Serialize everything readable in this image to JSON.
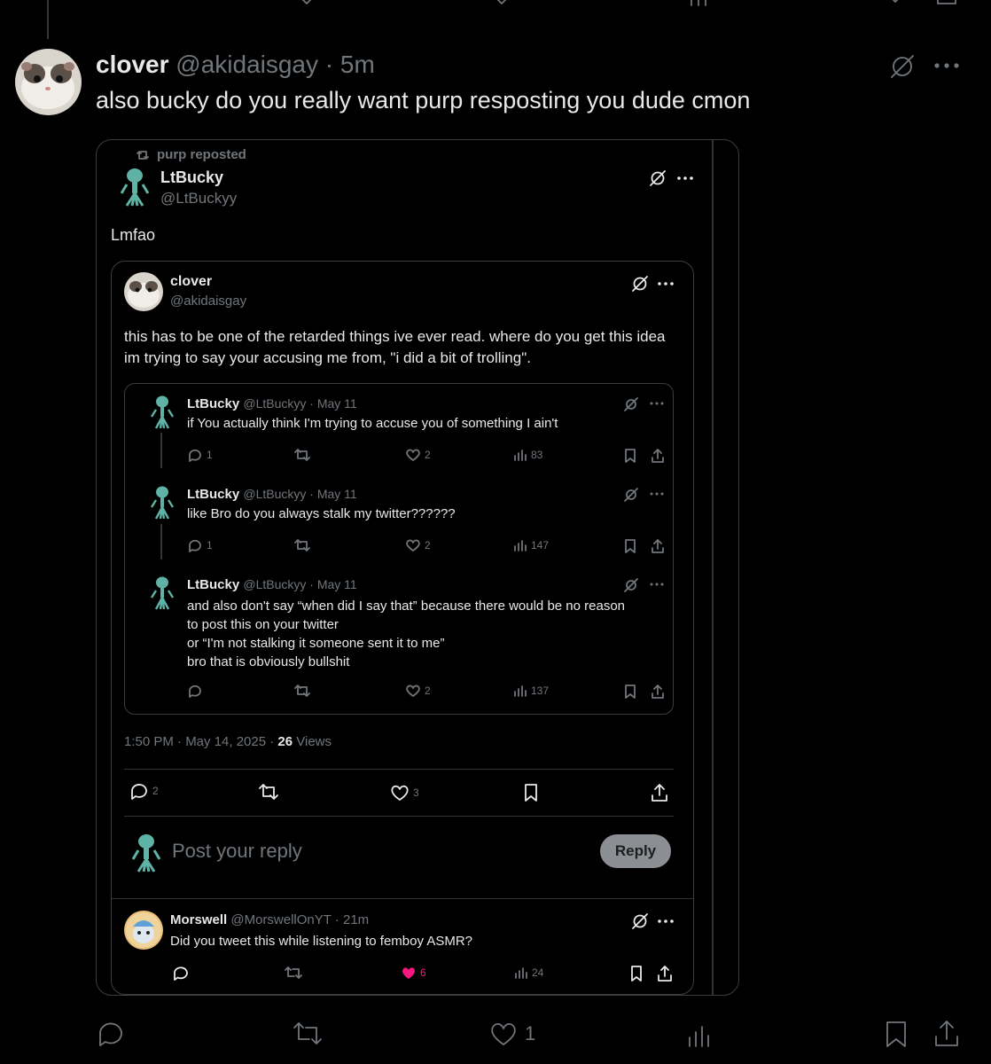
{
  "outer_tweet": {
    "display_name": "clover",
    "handle": "@akidaisgay",
    "separator": "·",
    "time": "5m",
    "text": "also bucky do you really want purp resposting you dude cmon",
    "actions": {
      "likes": "1"
    }
  },
  "screenshot": {
    "repost_label": "purp reposted",
    "main": {
      "display_name": "LtBucky",
      "handle": "@LtBuckyy",
      "text": "Lmfao"
    },
    "quoted": {
      "display_name": "clover",
      "handle": "@akidaisgay",
      "text": "this has to be one of the retarded things ive ever read. where do you get this idea im trying to say your accusing me from, \"i did a bit of trolling\"."
    },
    "thread": [
      {
        "display_name": "LtBucky",
        "meta": "@LtBuckyy · May 11",
        "text": "if You actually think I'm trying to accuse you of something I ain't",
        "replies": "1",
        "likes": "2",
        "views": "83"
      },
      {
        "display_name": "LtBucky",
        "meta": "@LtBuckyy · May 11",
        "text": "like Bro do you always stalk my twitter??????",
        "replies": "1",
        "likes": "2",
        "views": "147"
      },
      {
        "display_name": "LtBucky",
        "meta": "@LtBuckyy · May 11",
        "text_lines": [
          "and also don't say “when did I say that” because there would be no reason",
          "to post this on your twitter",
          "or “I'm not stalking it someone sent it to me”",
          "bro that is obviously bullshit"
        ],
        "likes": "2",
        "views": "137"
      }
    ],
    "timestamp": "1:50 PM · May 14, 2025 · ",
    "views_count": "26",
    "views_label": " Views",
    "stats": {
      "replies": "2",
      "likes": "3"
    },
    "reply_placeholder": "Post your reply",
    "reply_button": "Reply",
    "comment": {
      "display_name": "Morswell",
      "meta": "@MorswellOnYT · 21m",
      "text": "Did you tweet this while listening to femboy ASMR?",
      "likes": "6",
      "views": "24"
    }
  },
  "colors": {
    "background": "#000000",
    "text": "#e7e9ea",
    "muted": "#71767b",
    "like_pink": "#f91880",
    "border": "#3a3d41"
  }
}
